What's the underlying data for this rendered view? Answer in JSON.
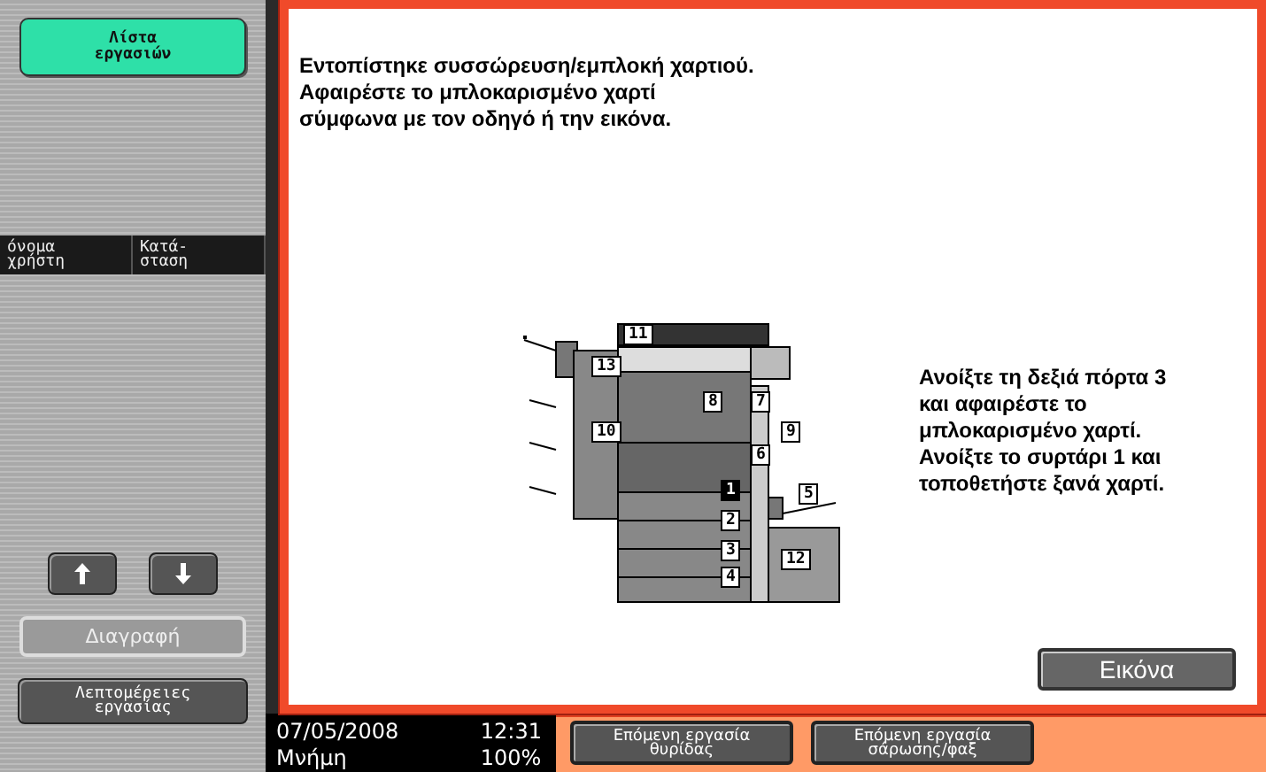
{
  "sidebar": {
    "job_list_button": "Λίστα\nεργασιών",
    "columns": [
      "όνομα\nχρήστη",
      "Κατά-\nσταση"
    ],
    "delete_button": {
      "label": "Διαγραφή",
      "disabled": true
    },
    "details_button": "Λεπτομέρειες\nεργασίας"
  },
  "message": "Εντοπίστηκε συσσώρευση/εμπλοκή χαρτιού.\nΑφαιρέστε το μπλοκαρισμένο χαρτί\nσύμφωνα με τον οδηγό ή την εικόνα.",
  "diagram_labels": [
    {
      "text": "11",
      "selected": false
    },
    {
      "text": "13",
      "selected": false
    },
    {
      "text": "8",
      "selected": false
    },
    {
      "text": "7",
      "selected": false
    },
    {
      "text": "10",
      "selected": false
    },
    {
      "text": "9",
      "selected": false
    },
    {
      "text": "6",
      "selected": false
    },
    {
      "text": "5",
      "selected": false
    },
    {
      "text": "1",
      "selected": true
    },
    {
      "text": "2",
      "selected": false
    },
    {
      "text": "3",
      "selected": false
    },
    {
      "text": "4",
      "selected": false
    },
    {
      "text": "12",
      "selected": false
    }
  ],
  "instructions": "Ανοίξτε τη δεξιά πόρτα 3\nκαι αφαιρέστε το\nμπλοκαρισμένο χαρτί.\nΑνοίξτε το συρτάρι 1 και\nτοποθετήστε ξανά χαρτί.",
  "image_button": "Εικόνα",
  "status": {
    "date": "07/05/2008",
    "time": "12:31",
    "memory_label": "Μνήμη",
    "memory_value": "100%"
  },
  "bottom_buttons": [
    "Επόμενη εργασία\nθυρίδας",
    "Επόμενη εργασία\nσάρωσης/φαξ"
  ]
}
